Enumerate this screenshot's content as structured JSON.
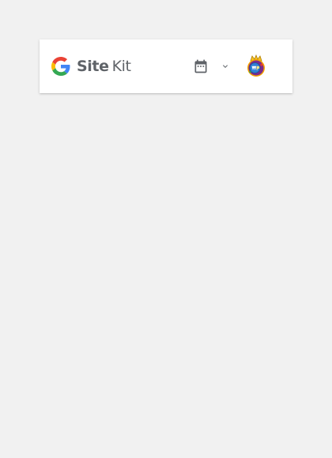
{
  "header": {
    "logo": {
      "site_label": "Site",
      "kit_label": "Kit",
      "icon": "google-g-icon"
    },
    "date_selector": {
      "icon": "calendar-icon",
      "dropdown_icon": "chevron-down-icon"
    },
    "user_avatar": {
      "icon": "avatar-image"
    }
  },
  "colors": {
    "page_background": "#f1f1f1",
    "header_background": "#ffffff",
    "logo_text": "#5f6368",
    "icon_gray": "#5f6368",
    "google_blue": "#4285F4",
    "google_red": "#EA4335",
    "google_yellow": "#FBBC05",
    "google_green": "#34A853"
  }
}
